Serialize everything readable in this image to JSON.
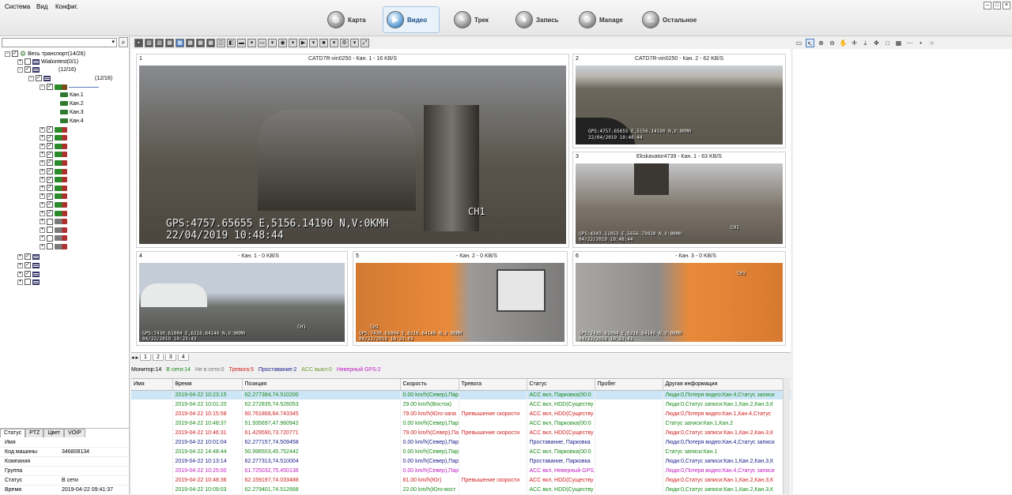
{
  "menu": {
    "items": [
      "Система",
      "Вид",
      "Конфиг."
    ]
  },
  "modes": [
    {
      "label": "Карта",
      "icon": "globe-icon",
      "active": false
    },
    {
      "label": "Видео",
      "icon": "video-icon",
      "active": true
    },
    {
      "label": "Трек",
      "icon": "track-icon",
      "active": false
    },
    {
      "label": "Запись",
      "icon": "record-icon",
      "active": false
    },
    {
      "label": "Manage",
      "icon": "manage-icon",
      "active": false
    },
    {
      "label": "Остальное",
      "icon": "other-icon",
      "active": false
    }
  ],
  "tree": {
    "root_label": "Весь транспорт(14/26)",
    "group1": "Wialontest(0/1)",
    "group2_count": "(12/16)",
    "group3_count": "(12/16)",
    "channels": [
      "Кан.1",
      "Кан.2",
      "Кан.3",
      "Кан.4"
    ]
  },
  "sidebar_tabs": [
    "Статус",
    "PTZ",
    "Цвет",
    "VOIP"
  ],
  "props": [
    {
      "k": "Имя",
      "v": ""
    },
    {
      "k": "Код машины",
      "v": "346808134"
    },
    {
      "k": "Компания",
      "v": ""
    },
    {
      "k": "Группа",
      "v": ""
    },
    {
      "k": "Статус",
      "v": "В сети"
    },
    {
      "k": "Время",
      "v": "2019-04-22 09:41:37"
    }
  ],
  "panels": [
    {
      "num": "1",
      "title": "CATD7R-vin0250 - Кан. 1 - 16 KB/S",
      "gps": "GPS:4757.65655 E,5156.14190 N,V:0KMH",
      "time": "22/04/2019 10:48:44",
      "ch": "CH1"
    },
    {
      "num": "2",
      "title": "CATD7R-vin0250 - Кан. 2 - 62 KB/S",
      "gps": "GPS:4757.65655 E,5156.14190 N,V:0KMH",
      "time": "22/04/2019 10:48:44",
      "ch": "CH2"
    },
    {
      "num": "3",
      "title": "Ekskavator4739 - Кан. 1 - 63 KB/S",
      "gps": "GPS:4343.11053 E,5656.79020 N,V:0KMH",
      "time": "04/22/2019 10:48:44",
      "ch": "CH1"
    },
    {
      "num": "4",
      "title": "- Кан. 1 - 0 KB/S",
      "gps": "GPS:7430.61004 E,6216.64146 N,V:0KMH",
      "time": "04/22/2019 10:23:43",
      "ch": "CH1"
    },
    {
      "num": "5",
      "title": "- Кан. 2 - 0 KB/S",
      "gps": "GPS:7430.61004 E,6216.64146 N,V:0KMH",
      "time": "04/22/2019 10:23:43",
      "ch": "CH2"
    },
    {
      "num": "6",
      "title": "- Кан. 3 - 0 KB/S",
      "gps": "GPS:7430.61004 E,6216.64146 N,V:0KMH",
      "time": "04/22/2019 10:23:43",
      "ch": "CH3"
    }
  ],
  "page_tabs": [
    "1",
    "2",
    "3",
    "4"
  ],
  "status_counts": [
    {
      "text": "Монитор:14",
      "color": "#000000"
    },
    {
      "text": "В сети:14",
      "color": "#1a8a1a"
    },
    {
      "text": "Не в сети:0",
      "color": "#777777"
    },
    {
      "text": "Тревога:5",
      "color": "#d02020"
    },
    {
      "text": "Проставание:2",
      "color": "#1a1a8a"
    },
    {
      "text": "ACC выкл:0",
      "color": "#6a9a2a"
    },
    {
      "text": "Неверный GPS:2",
      "color": "#c020c0"
    }
  ],
  "grid": {
    "columns": [
      "Имя",
      "Время",
      "Позиция",
      "Скорость",
      "Тревога",
      "Статус",
      "Пробег",
      "Другая информация"
    ],
    "rows": [
      {
        "c": "#1a8a1a",
        "sel": true,
        "cells": [
          "",
          "2019-04-22 10:23:15",
          "62.277384,74.510200",
          "0.00 km/h(Север),Пар",
          "",
          "ACC вкл, Парковка(00:0",
          "",
          "Люди:0,Потеря видео:Кан.4,Статус записи"
        ]
      },
      {
        "c": "#1a8a1a",
        "sel": false,
        "cells": [
          "",
          "2019-04-22 10:01:20",
          "62.272835,74.526053",
          "29.00 km/h(Восток)",
          "",
          "ACC вкл, HDD(Существу",
          "",
          "Люди:0,Статус записи:Кан.1,Кан.2,Кан.3,К"
        ]
      },
      {
        "c": "#d02020",
        "sel": false,
        "cells": [
          "",
          "2019-04-22 10:15:58",
          "60.761868,64.743345",
          "79.00 km/h(Юго-запа",
          "Превышение скорости",
          "ACC вкл, HDD(Существу",
          "",
          "Люди:0,Потеря видео:Кан.1,Кан.4,Статус"
        ]
      },
      {
        "c": "#1a8a1a",
        "sel": false,
        "cells": [
          "",
          "2019-04-22 10:48:37",
          "51.935697,47.960942",
          "0.00 km/h(Север),Пар",
          "",
          "ACC вкл, Парковка(00:0",
          "",
          "Статус записи:Кан.1,Кан.2"
        ]
      },
      {
        "c": "#d02020",
        "sel": false,
        "cells": [
          "",
          "2019-04-22 10:46:31",
          "61.429590,73.720771",
          "79.00 km/h(Север),Пар",
          "Превышение скорости",
          "ACC вкл, HDD(Существу",
          "",
          "Люди:0,Статус записи:Кан.1,Кан.2,Кан.3,К"
        ]
      },
      {
        "c": "#1a1a8a",
        "sel": false,
        "cells": [
          "",
          "2019-04-22 10:01:04",
          "62.277157,74.509458",
          "0.00 km/h(Север),Пар",
          "",
          "Проставание, Парковка",
          "",
          "Люди:0,Потеря видео:Кан.4,Статус записи"
        ]
      },
      {
        "c": "#1a8a1a",
        "sel": false,
        "cells": [
          "",
          "2019-04-22 14:48:44",
          "50.996503,45.752442",
          "0.00 km/h(Север),Пар",
          "",
          "ACC вкл, Парковка(00:0",
          "",
          "Статус записи:Кан.1"
        ]
      },
      {
        "c": "#1a1a8a",
        "sel": false,
        "cells": [
          "",
          "2019-04-22 10:13:14",
          "62.277313,74.510004",
          "0.00 km/h(Север),Пар",
          "",
          "Проставание, Парковка",
          "",
          "Люди:0,Статус записи:Кан.1,Кан.2,Кан.3,К"
        ]
      },
      {
        "c": "#c020c0",
        "sel": false,
        "cells": [
          "",
          "2019-04-22 10:25:00",
          "61.725032,75.450136",
          "0.00 km/h(Север),Пар",
          "",
          "ACC вкл, Неверный GPS,",
          "",
          "Люди:0,Потеря видео:Кан.4,Статус записи"
        ]
      },
      {
        "c": "#d02020",
        "sel": false,
        "cells": [
          "",
          "2019-04-22 10:48:36",
          "62.159197,74.033488",
          "81.00 km/h(Юг)",
          "Превышение скорости",
          "ACC вкл, HDD(Существу",
          "",
          "Люди:0,Статус записи:Кан.1,Кан.2,Кан.3,К"
        ]
      },
      {
        "c": "#1a8a1a",
        "sel": false,
        "cells": [
          "",
          "2019-04-22 10:09:03",
          "62.279401,74.512668",
          "22.00 km/h(Юго-вост",
          "",
          "ACC вкл, HDD(Существу",
          "",
          "Люди:0,Статус записи:Кан.1,Кан.2,Кан.3,К"
        ]
      }
    ]
  }
}
